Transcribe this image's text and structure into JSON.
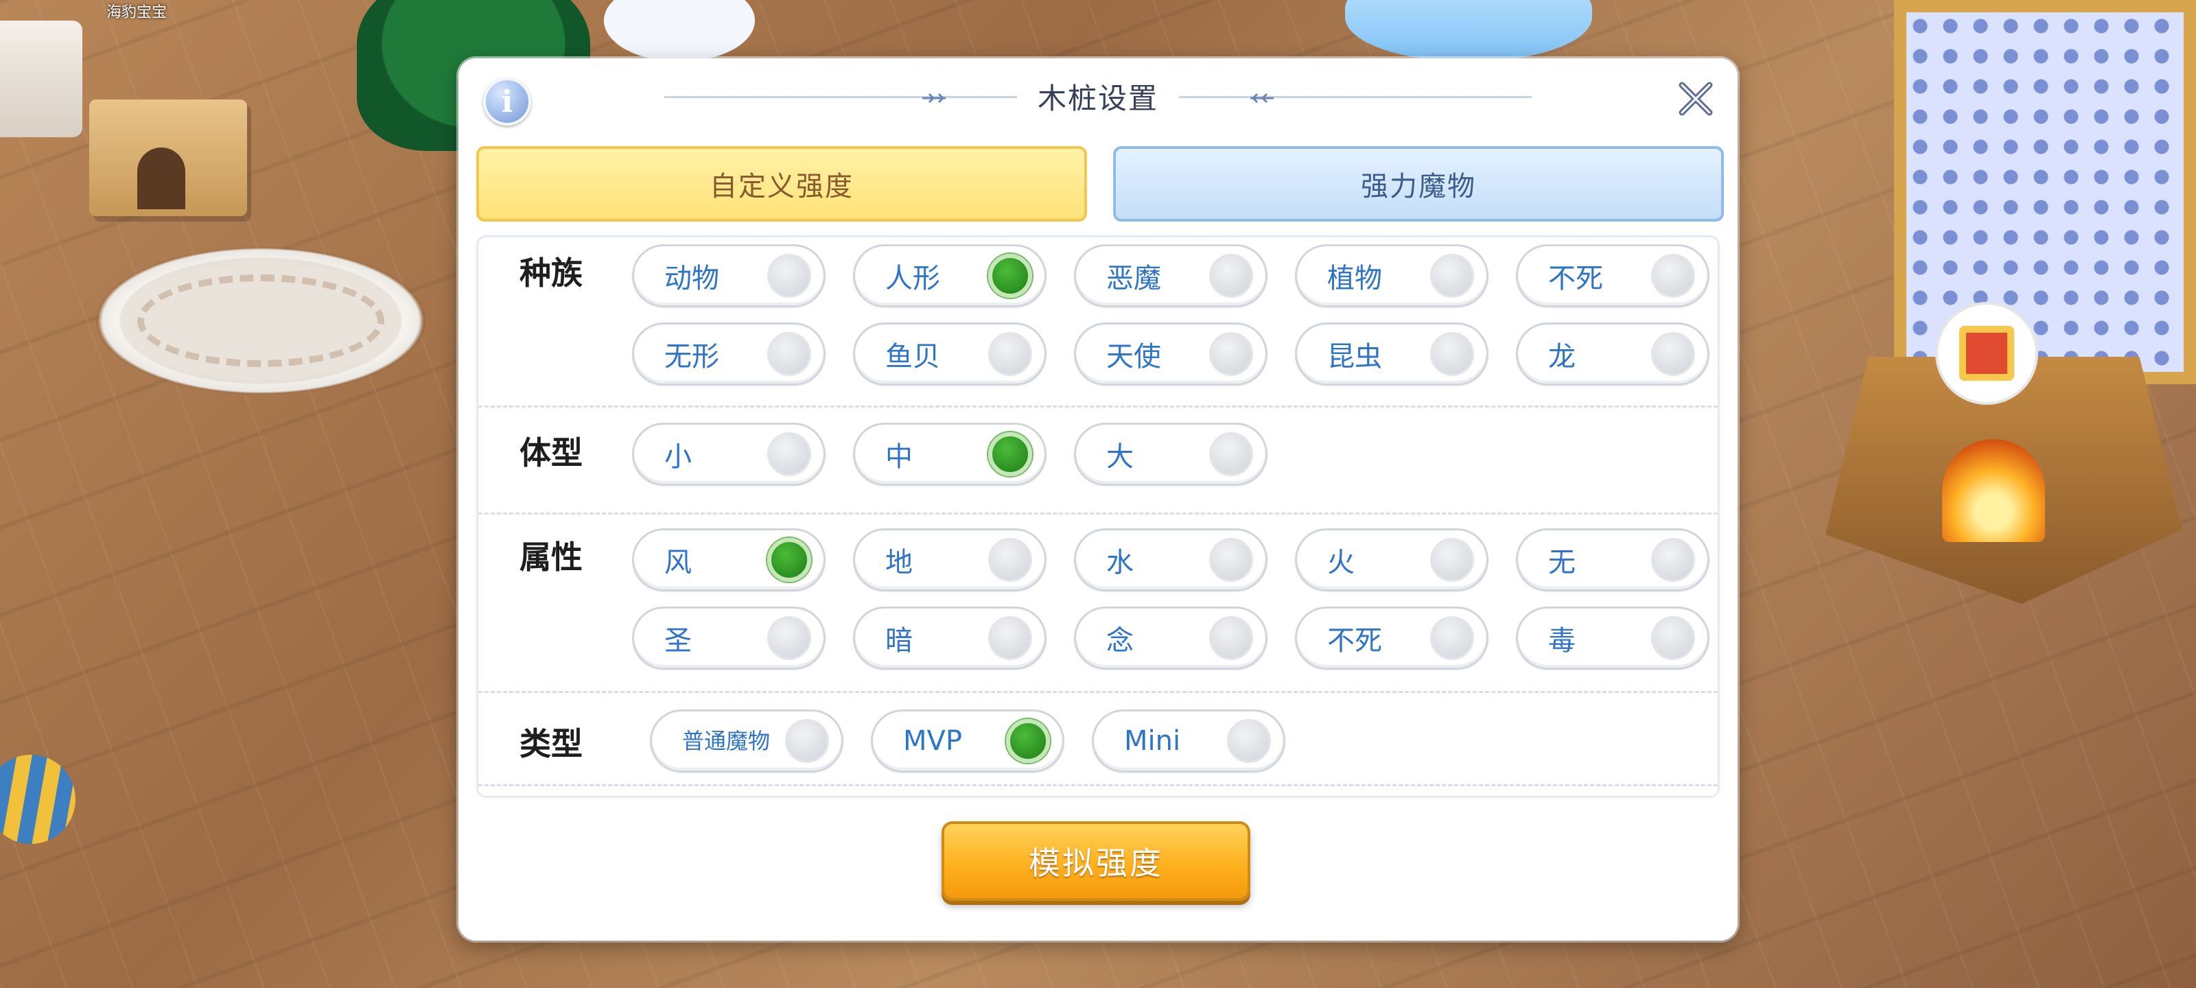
{
  "background": {
    "pet_name": "海豹宝宝"
  },
  "dialog": {
    "title": "木桩设置",
    "info_icon": "i"
  },
  "tabs": [
    {
      "label": "自定义强度",
      "active": true
    },
    {
      "label": "强力魔物",
      "active": false
    }
  ],
  "sections": {
    "race": {
      "label": "种族",
      "options": [
        {
          "label": "动物",
          "selected": false
        },
        {
          "label": "人形",
          "selected": true
        },
        {
          "label": "恶魔",
          "selected": false
        },
        {
          "label": "植物",
          "selected": false
        },
        {
          "label": "不死",
          "selected": false
        },
        {
          "label": "无形",
          "selected": false
        },
        {
          "label": "鱼贝",
          "selected": false
        },
        {
          "label": "天使",
          "selected": false
        },
        {
          "label": "昆虫",
          "selected": false
        },
        {
          "label": "龙",
          "selected": false
        }
      ]
    },
    "size": {
      "label": "体型",
      "options": [
        {
          "label": "小",
          "selected": false
        },
        {
          "label": "中",
          "selected": true
        },
        {
          "label": "大",
          "selected": false
        }
      ]
    },
    "element": {
      "label": "属性",
      "options": [
        {
          "label": "风",
          "selected": true
        },
        {
          "label": "地",
          "selected": false
        },
        {
          "label": "水",
          "selected": false
        },
        {
          "label": "火",
          "selected": false
        },
        {
          "label": "无",
          "selected": false
        },
        {
          "label": "圣",
          "selected": false
        },
        {
          "label": "暗",
          "selected": false
        },
        {
          "label": "念",
          "selected": false
        },
        {
          "label": "不死",
          "selected": false
        },
        {
          "label": "毒",
          "selected": false
        }
      ]
    },
    "type": {
      "label": "类型",
      "options": [
        {
          "label": "普通魔物",
          "selected": false
        },
        {
          "label": "MVP",
          "selected": true
        },
        {
          "label": "Mini",
          "selected": false
        }
      ]
    }
  },
  "simulate_button": {
    "label": "模拟强度"
  },
  "colors": {
    "option_text": "#2f74c6",
    "radio_selected": "#1d7d16",
    "tab_active": "#ffe27a",
    "tab_inactive": "#c5def8",
    "simulate_button": "#ffb11f"
  }
}
